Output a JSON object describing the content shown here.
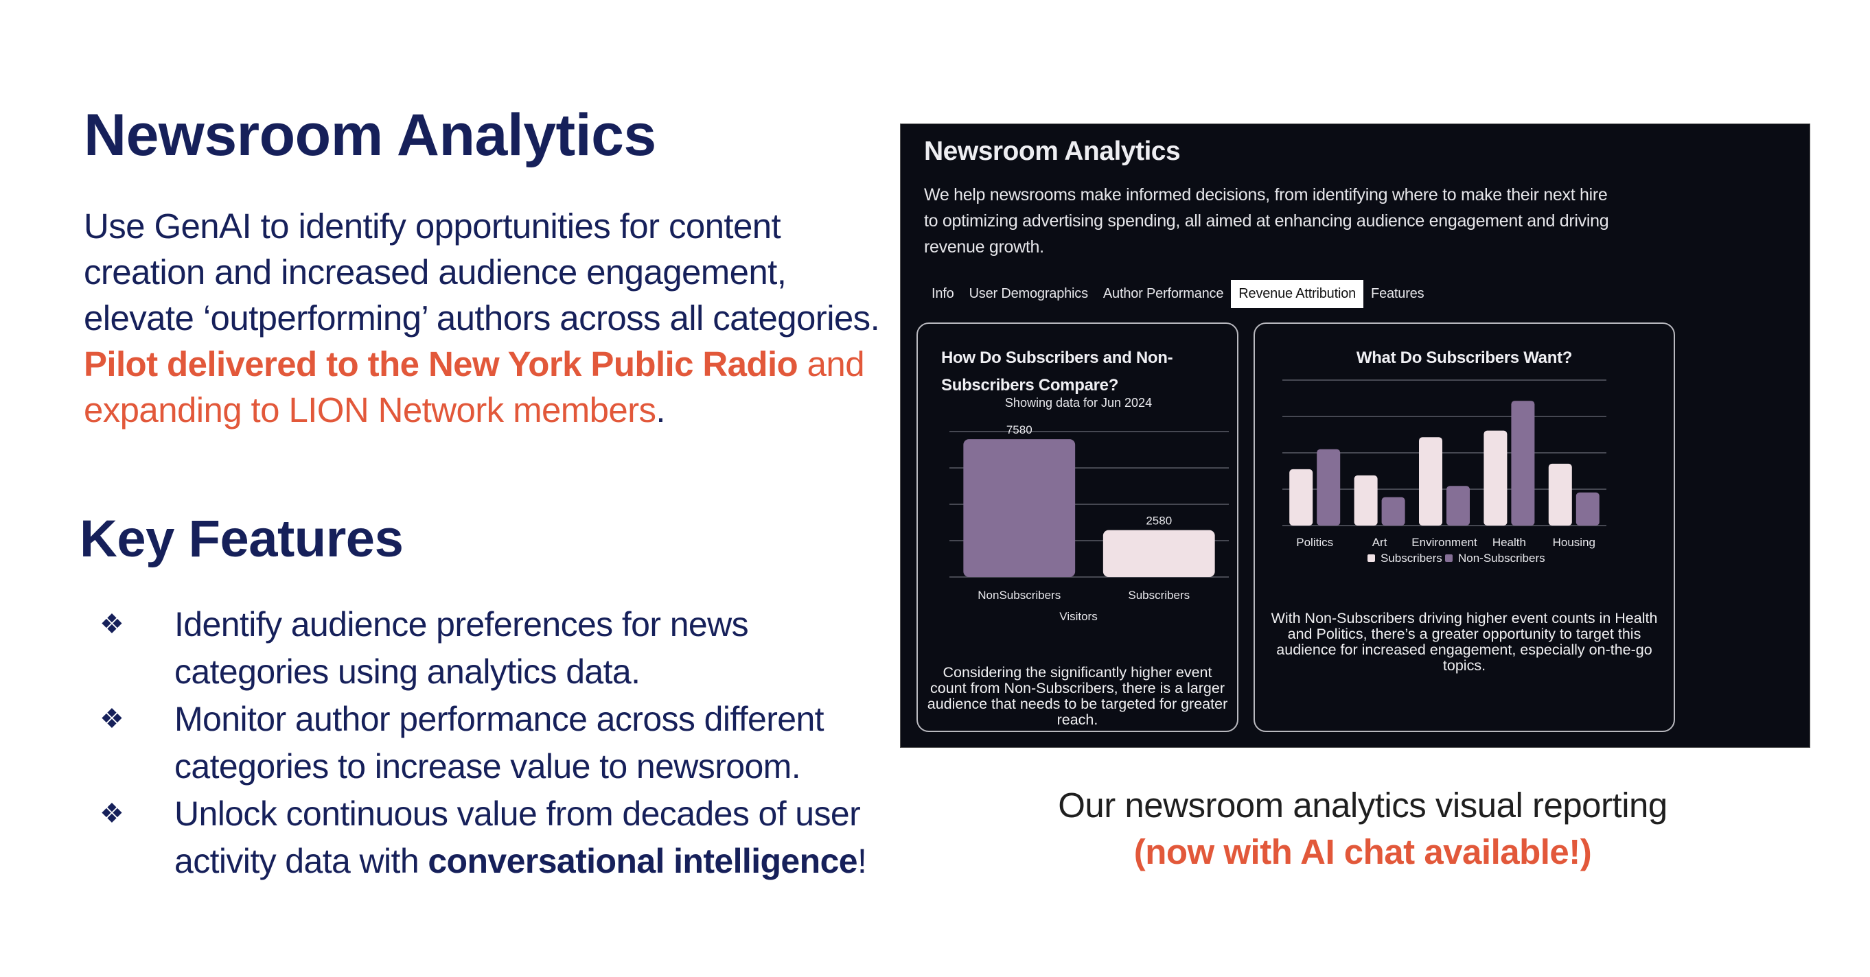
{
  "slide": {
    "title": "Newsroom Analytics",
    "intro": {
      "text_plain": "Use GenAI to identify opportunities for content creation and increased audience engagement, elevate ‘outperforming’ authors across all categories. ",
      "text_highlight_bold": "Pilot delivered to the New York Public Radio",
      "text_highlight": " and expanding to LION Network members",
      "text_end": "."
    },
    "key_features_title": "Key Features",
    "bullet_glyph": "❖",
    "features": [
      {
        "text": "Identify audience preferences for news categories using analytics data.",
        "bold": "",
        "end": ""
      },
      {
        "text": "Monitor author performance across different categories to increase value to newsroom.",
        "bold": "",
        "end": ""
      },
      {
        "text": "Unlock continuous value from decades of user activity data with ",
        "bold": "conversational intelligence",
        "end": "!"
      }
    ],
    "caption_line1": "Our newsroom analytics visual reporting",
    "caption_line2": "(now with AI chat available!)"
  },
  "colors": {
    "navy": "#16205a",
    "orange": "#e2583a",
    "dash_bg": "#0a0c14",
    "purple": "#856f96",
    "pale": "#f0e1e5",
    "grid": "#5a5c66"
  },
  "dashboard": {
    "title": "Newsroom Analytics",
    "description": "We help newsrooms make informed decisions, from identifying where to make their next hire to optimizing advertising spending, all aimed at enhancing audience engagement and driving revenue growth.",
    "tabs": [
      {
        "label": "Info",
        "active": false
      },
      {
        "label": "User Demographics",
        "active": false
      },
      {
        "label": "Author Performance",
        "active": false
      },
      {
        "label": "Revenue Attribution",
        "active": true
      },
      {
        "label": "Features",
        "active": false
      }
    ],
    "cards": [
      {
        "title": "How Do Subscribers and Non-Subscribers Compare?",
        "note": "Considering the significantly higher event count from Non-Subscribers, there is a larger audience that needs to be targeted for greater reach."
      },
      {
        "title": "What Do Subscribers Want?",
        "note": "With Non-Subscribers driving higher event counts in Health and Politics, there’s a greater opportunity to target this audience for increased engagement, especially on-the-go topics."
      }
    ]
  },
  "chart_data": [
    {
      "type": "bar",
      "title": "How Do Subscribers and Non-Subscribers Compare?",
      "subtitle": "Showing data for Jun 2024",
      "categories": [
        "NonSubscribers",
        "Subscribers"
      ],
      "values": [
        7580,
        2580
      ],
      "data_labels": [
        "7580",
        "2580"
      ],
      "xlabel": "Visitors",
      "ylabel": "",
      "ylim": [
        0,
        8000
      ],
      "gridlines": [
        0,
        2000,
        4000,
        6000,
        8000
      ],
      "grid": true,
      "bar_colors": [
        "#856f96",
        "#f0e1e5"
      ]
    },
    {
      "type": "bar",
      "title": "What Do Subscribers Want?",
      "categories": [
        "Politics",
        "Art",
        "Environment",
        "Health",
        "Housing"
      ],
      "series": [
        {
          "name": "Subscribers",
          "color": "#f0e1e5",
          "values": [
            1.55,
            1.38,
            2.43,
            2.61,
            1.7
          ]
        },
        {
          "name": "Non-Subscribers",
          "color": "#856f96",
          "values": [
            2.1,
            0.78,
            1.09,
            3.43,
            0.91
          ]
        }
      ],
      "value_units": "relative (gridline units, axis unlabeled)",
      "ylim": [
        0,
        4
      ],
      "gridlines": [
        0,
        1,
        2,
        3,
        4
      ],
      "grid": true,
      "legend": "bottom-center",
      "xlabel": "",
      "ylabel": ""
    }
  ]
}
